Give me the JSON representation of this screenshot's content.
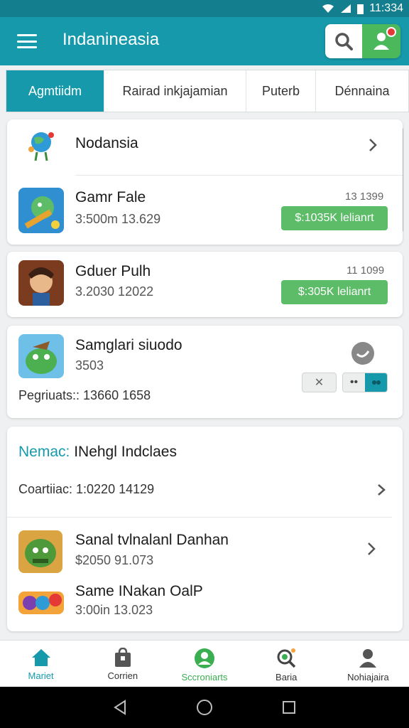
{
  "status": {
    "time": "11:334"
  },
  "appbar": {
    "title": "Indanineasia"
  },
  "tabs": [
    {
      "label": "Agmtiidm",
      "active": true
    },
    {
      "label": "Rairad inkjajamian",
      "active": false
    },
    {
      "label": "Puterb",
      "active": false
    },
    {
      "label": "Dénnaina",
      "active": false
    }
  ],
  "card1": {
    "header": "Nodansia",
    "item": {
      "title": "Gamr Fale",
      "meta": "3:500m   13.629",
      "date": "13 1399",
      "button": "$:1035K lelianrt"
    }
  },
  "card2": {
    "item": {
      "title": "Gduer Pulh",
      "meta": "3.2030   12022",
      "date": "11 1099",
      "button": "$:305K lelianrt"
    }
  },
  "card3": {
    "title": "Samglari siuodo",
    "meta": "3503",
    "footer": "Pegriuats:: 13660   1658",
    "close_label": "✕",
    "dots_label": "••"
  },
  "card4": {
    "title_accent": "Nemac:",
    "title_rest": " INehgl Indclaes",
    "subline": "Coartiiac: 1:0220   14129",
    "items": [
      {
        "title": "Sanal tvlnalanl Danhan",
        "meta": "$2050   91.073"
      },
      {
        "title": "Same INakan OalP",
        "meta": "3:00in   13.023"
      }
    ]
  },
  "bottomnav": [
    {
      "label": "Mariet",
      "icon": "home-icon"
    },
    {
      "label": "Corrien",
      "icon": "bag-icon"
    },
    {
      "label": "Sccroniarts",
      "icon": "account-icon"
    },
    {
      "label": "Baria",
      "icon": "search-icon"
    },
    {
      "label": "Nohiajaira",
      "icon": "person-icon"
    }
  ],
  "colors": {
    "primary": "#169aab",
    "accent_green": "#5cbc68",
    "notification": "#e53935"
  }
}
